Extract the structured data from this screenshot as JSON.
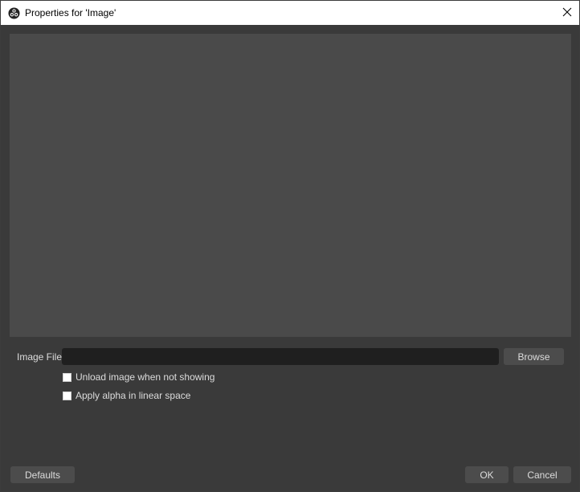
{
  "window": {
    "title": "Properties for 'Image'",
    "icons": {
      "app": "obs-logo-icon",
      "close": "close-icon"
    }
  },
  "form": {
    "image_file_label": "Image File",
    "image_file_value": "",
    "browse_label": "Browse",
    "options": [
      {
        "label": "Unload image when not showing",
        "checked": false
      },
      {
        "label": "Apply alpha in linear space",
        "checked": false
      }
    ]
  },
  "footer": {
    "defaults_label": "Defaults",
    "ok_label": "OK",
    "cancel_label": "Cancel"
  },
  "colors": {
    "dialog_background": "#3a3a3a",
    "preview_background": "#4a4a4a",
    "input_background": "#1f1f1f",
    "button_background": "#4c4c4c",
    "text": "#dcdcdc"
  }
}
